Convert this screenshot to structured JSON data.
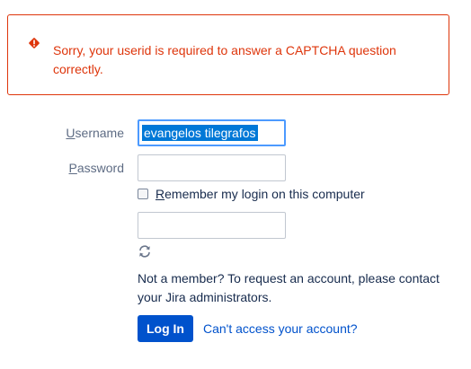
{
  "error": {
    "message": "Sorry, your userid is required to answer a CAPTCHA question correctly.",
    "color": "#de350b"
  },
  "form": {
    "username": {
      "label_accesskey": "U",
      "label_rest": "sername",
      "value": "evangelos tilegrafos"
    },
    "password": {
      "label_accesskey": "P",
      "label_rest": "assword",
      "value": ""
    },
    "remember": {
      "label_accesskey": "R",
      "label_rest": "emember my login on this computer",
      "checked": false
    },
    "captcha": {
      "value": "",
      "refresh_icon": "refresh-icon"
    },
    "contact_text": "Not a member? To request an account, please contact your Jira administrators.",
    "login_button_label": "Log In",
    "cant_access_link": "Can't access your account?"
  },
  "colors": {
    "primary": "#0052cc",
    "focus_border": "#4c9aff",
    "selection": "#0078d7"
  }
}
